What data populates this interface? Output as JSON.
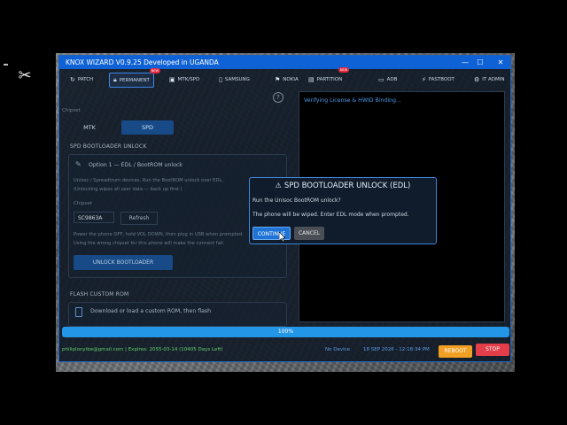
{
  "desktop": {
    "left_icon": "capcut-icon"
  },
  "window": {
    "title": "KNOX WIZARD V0.9.25  Developed in UGANDA",
    "controls": [
      "—",
      "☐",
      "✕"
    ]
  },
  "tabs": [
    {
      "label": "PATCH",
      "icon": "history-icon",
      "new": false
    },
    {
      "label": "PERMANENT",
      "icon": "lock-icon",
      "new": true,
      "active": true
    },
    {
      "label": "MTK/SPD",
      "icon": "chip-icon",
      "new": false
    },
    {
      "label": "SAMSUNG",
      "icon": "phone-icon",
      "new": false
    },
    {
      "label": "NOKIA",
      "icon": "nokia-icon",
      "new": false
    },
    {
      "label": "PARTITION",
      "icon": "partition-icon",
      "new": true
    },
    {
      "label": "ADB",
      "icon": "adb-icon",
      "new": false
    },
    {
      "label": "FASTBOOT",
      "icon": "bolt-icon",
      "new": false
    },
    {
      "label": "IT ADMIN",
      "icon": "admin-icon",
      "new": false
    }
  ],
  "new_badge": "NEW",
  "chipset": {
    "label": "Chipset",
    "options": [
      "MTK",
      "SPD"
    ],
    "selected": "SPD"
  },
  "spd_unlock": {
    "heading": "SPD BOOTLOADER UNLOCK",
    "option_title": "Option 1  —  EDL / BootROM unlock",
    "desc1": "Unisoc / Spreadtrum devices. Run the BootROM unlock over EDL.",
    "desc2": "(Unlocking wipes all user data — back up first.)",
    "chip_label": "Chipset",
    "chip_value": "SC9863A",
    "refresh_label": "Refresh",
    "hint1": "Power the phone OFF, hold VOL DOWN, then plug in USB when prompted.",
    "hint2": "Using the wrong chipset for this phone will make the connect fail.",
    "button": "UNLOCK BOOTLOADER"
  },
  "flash_rom": {
    "heading": "FLASH CUSTOM ROM",
    "text": "Download or load a custom ROM, then flash"
  },
  "log": {
    "line": "Verifying License & HWID Binding..."
  },
  "progress": {
    "value": 100,
    "label": "100%"
  },
  "status": {
    "user": "philiplonyibe@gmail.com | Expires: 2055-03-14 (10405 Days Left)",
    "device": "No Device",
    "datetime": "18 SEP 2026 - 12:18:34 PM",
    "reboot": "REBOOT",
    "stop": "STOP"
  },
  "dialog": {
    "icon": "warning-icon",
    "title": "SPD BOOTLOADER UNLOCK (EDL)",
    "question": "Run the Unisoc BootROM unlock?",
    "message": "The phone will be wiped. Enter EDL mode when prompted.",
    "continue_label": "CONTINUE",
    "cancel_label": "CANCEL"
  },
  "colors": {
    "titlebar": "#0f62d6",
    "accent": "#2496e8",
    "reboot": "#f2a024",
    "stop": "#e23d48",
    "new_badge": "#e2293d"
  }
}
